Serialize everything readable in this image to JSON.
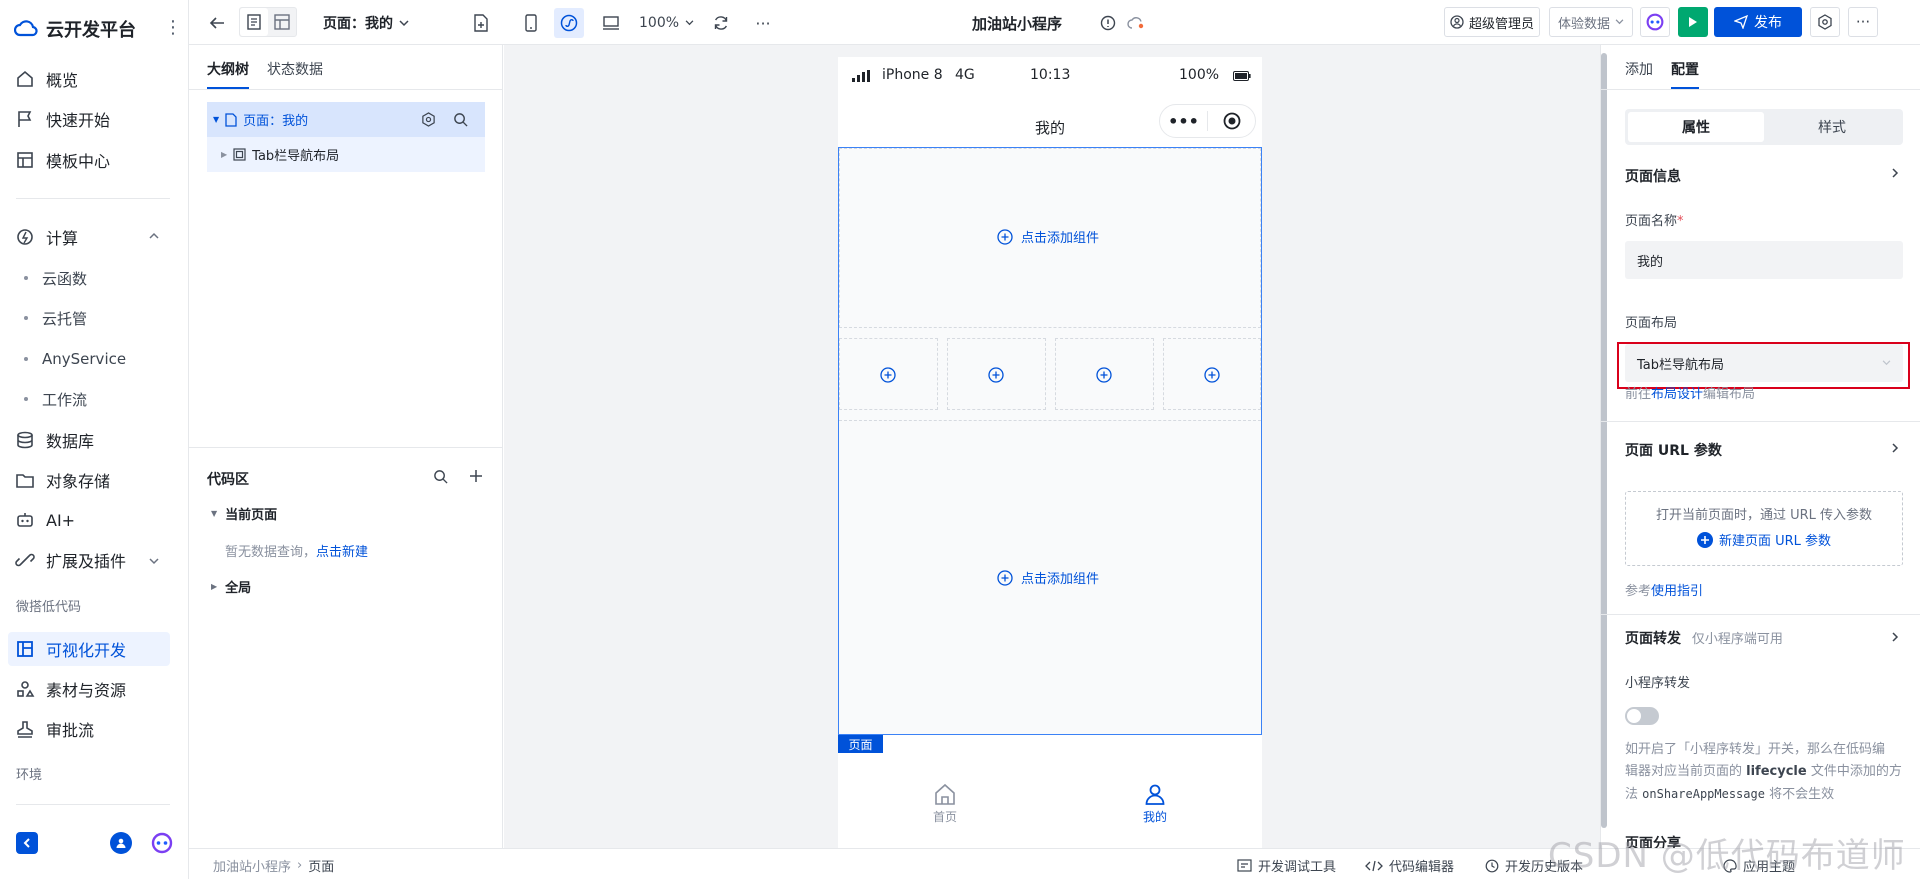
{
  "sidebar": {
    "logo": "云开发平台",
    "items": [
      {
        "label": "概览",
        "icon": "home-icon"
      },
      {
        "label": "快速开始",
        "icon": "flag-icon"
      },
      {
        "label": "模板中心",
        "icon": "template-icon"
      },
      {
        "label": "计算",
        "icon": "compute-icon"
      },
      {
        "label": "数据库",
        "icon": "database-icon"
      },
      {
        "label": "对象存储",
        "icon": "folder-icon"
      },
      {
        "label": "AI+",
        "icon": "robot-icon"
      },
      {
        "label": "扩展及插件",
        "icon": "plugin-icon"
      },
      {
        "label": "可视化开发",
        "icon": "layout-icon"
      },
      {
        "label": "素材与资源",
        "icon": "shapes-icon"
      },
      {
        "label": "审批流",
        "icon": "stamp-icon"
      }
    ],
    "compute_sub": [
      "云函数",
      "云托管",
      "AnyService",
      "工作流"
    ],
    "section_lowcode": "微搭低代码",
    "section_env": "环境"
  },
  "toolbar": {
    "page_selector": "页面：我的",
    "zoom": "100%",
    "app_title": "加油站小程序",
    "user_role": "超级管理员",
    "data_mode": "体验数据",
    "publish": "发布"
  },
  "outline": {
    "tabs": [
      "大纲树",
      "状态数据"
    ],
    "tree_page": "页面：我的",
    "tree_child": "Tab栏导航布局",
    "code_title": "代码区",
    "current_page": "当前页面",
    "empty_text": "暂无数据查询，",
    "create_link": "点击新建",
    "global": "全局"
  },
  "phone": {
    "carrier": "iPhone 8",
    "network": "4G",
    "time": "10:13",
    "battery": "100%",
    "title": "我的",
    "add_component": "点击添加组件",
    "page_tag": "页面",
    "tabs": [
      {
        "label": "首页",
        "icon": "home-icon"
      },
      {
        "label": "我的",
        "icon": "user-icon"
      }
    ]
  },
  "rpanel": {
    "tabs": [
      "添加",
      "配置"
    ],
    "seg": [
      "属性",
      "样式"
    ],
    "page_info": "页面信息",
    "page_name_label": "页面名称",
    "page_name_value": "我的",
    "layout_label": "页面布局",
    "layout_value": "Tab栏导航布局",
    "layout_hint_pre": "前往",
    "layout_hint_link": "布局设计",
    "layout_hint_post": "编辑布局",
    "url_params": "页面 URL 参数",
    "url_desc": "打开当前页面时，通过 URL 传入参数",
    "url_new": "新建页面 URL 参数",
    "ref_pre": "参考",
    "ref_link": "使用指引",
    "forward_title": "页面转发",
    "forward_note": "仅小程序端可用",
    "mini_forward": "小程序转发",
    "desc_1": "如开启了「小程序转发」开关，那么在低码编",
    "desc_2": "辑器对应当前页面的 ",
    "desc_bold": "lifecycle",
    "desc_3": " 文件中添加的方",
    "desc_4": "法 ",
    "desc_code": "onShareAppMessage",
    "desc_5": " 将不会生效",
    "cut_title": "页面分享"
  },
  "bottombar": {
    "crumb_app": "加油站小程序",
    "crumb_page": "页面",
    "debug": "开发调试工具",
    "code_editor": "代码编辑器",
    "history": "开发历史版本",
    "theme": "应用主题"
  },
  "watermark": "CSDN @低代码布道师",
  "colors": {
    "accent": "#0052d9",
    "publish": "#0052d9",
    "preview": "#00a870",
    "highlight_box": "#d9001b"
  }
}
